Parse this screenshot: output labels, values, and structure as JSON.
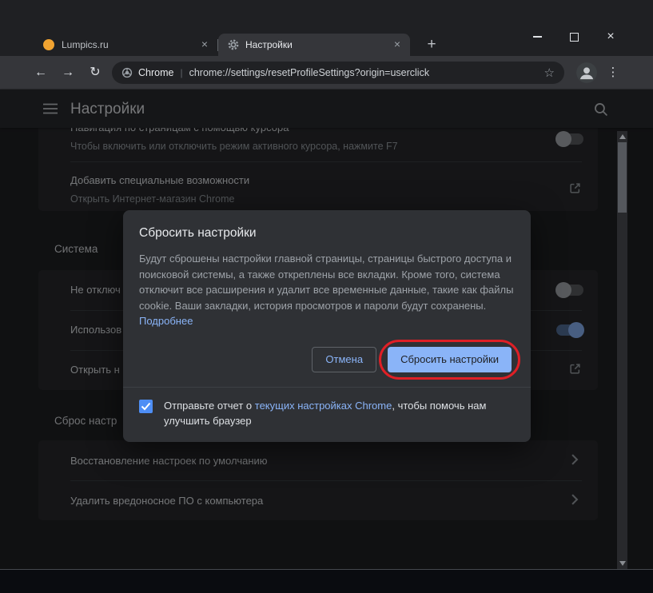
{
  "colors": {
    "accent": "#8ab4f8",
    "annotation_red": "#df1f26",
    "confirm_button_bg": "#8ab4f8",
    "checkbox_blue": "#4e8ef5"
  },
  "icons": {
    "back": "←",
    "forward": "→",
    "reload": "↻",
    "star": "☆",
    "overflow_menu": "⋮",
    "new_tab": "+",
    "tab_close": "×",
    "window_close": "×",
    "url_separator": "|"
  },
  "titlebar": {
    "tabs": [
      {
        "label": "Lumpics.ru"
      },
      {
        "label": "Настройки"
      }
    ]
  },
  "toolbar": {
    "site_chip": "Chrome",
    "url": "chrome://settings/resetProfileSettings?origin=userclick"
  },
  "settings_header": {
    "title": "Настройки"
  },
  "settings_page": {
    "cursor_row": {
      "title": "Навигация по страницам с помощью курсора",
      "subtitle": "Чтобы включить или отключить режим активного курсора, нажмите F7"
    },
    "accessibility_row": {
      "title": "Добавить специальные возможности",
      "subtitle": "Открыть Интернет-магазин Chrome"
    },
    "system_section": "Система",
    "system_row_1": "Не отключ",
    "system_row_2": "Использов",
    "system_row_3": "Открыть н",
    "reset_section": "Сброс настр",
    "restore_row": "Восстановление настроек по умолчанию",
    "cleanup_row": "Удалить вредоносное ПО с компьютера"
  },
  "dialog": {
    "title": "Сбросить настройки",
    "body": "Будут сброшены настройки главной страницы, страницы быстрого доступа и поисковой системы, а также откреплены все вкладки. Кроме того, система отключит все расширения и удалит все временные данные, такие как файлы cookie. Ваши закладки, история просмотров и пароли будут сохранены.",
    "learn_more": "Подробнее",
    "cancel_label": "Отмена",
    "confirm_label": "Сбросить настройки",
    "checkbox": {
      "prefix": "Отправьте отчет о ",
      "link": "текущих настройках Chrome",
      "suffix": ", чтобы помочь нам улучшить браузер",
      "checked": true
    }
  }
}
